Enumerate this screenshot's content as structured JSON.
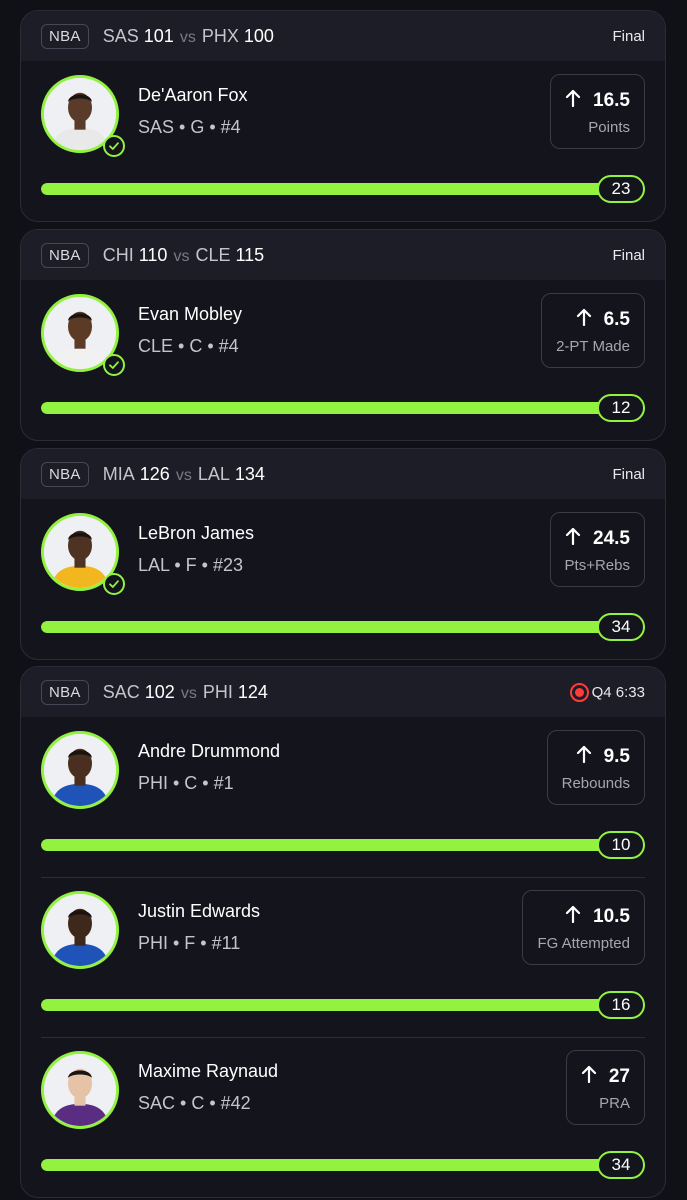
{
  "colors": {
    "background": "#101017",
    "card": "#14141d",
    "accent_green": "#93f240",
    "live_red": "#ff3b3b"
  },
  "games": [
    {
      "league": "NBA",
      "away_team": "SAS",
      "away_score": "101",
      "vs": "vs",
      "home_team": "PHX",
      "home_score": "100",
      "status": "Final",
      "live": false,
      "players": [
        {
          "name": "De'Aaron Fox",
          "meta": "SAS • G • #4",
          "line": "16.5",
          "stat": "Points",
          "actual": "23",
          "progress": 1.0,
          "hit": true,
          "jersey_color": "#e9e9ea",
          "skin": "#5a3a28"
        }
      ]
    },
    {
      "league": "NBA",
      "away_team": "CHI",
      "away_score": "110",
      "vs": "vs",
      "home_team": "CLE",
      "home_score": "115",
      "status": "Final",
      "live": false,
      "players": [
        {
          "name": "Evan Mobley",
          "meta": "CLE • C • #4",
          "line": "6.5",
          "stat": "2-PT Made",
          "actual": "12",
          "progress": 1.0,
          "hit": true,
          "jersey_color": "#f1f1f1",
          "skin": "#5b3a26"
        }
      ]
    },
    {
      "league": "NBA",
      "away_team": "MIA",
      "away_score": "126",
      "vs": "vs",
      "home_team": "LAL",
      "home_score": "134",
      "status": "Final",
      "live": false,
      "players": [
        {
          "name": "LeBron James",
          "meta": "LAL • F • #23",
          "line": "24.5",
          "stat": "Pts+Rebs",
          "actual": "34",
          "progress": 1.0,
          "hit": true,
          "jersey_color": "#f2b71e",
          "skin": "#4e3323"
        }
      ]
    },
    {
      "league": "NBA",
      "away_team": "SAC",
      "away_score": "102",
      "vs": "vs",
      "home_team": "PHI",
      "home_score": "124",
      "status": "Q4 6:33",
      "live": true,
      "players": [
        {
          "name": "Andre Drummond",
          "meta": "PHI • C • #1",
          "line": "9.5",
          "stat": "Rebounds",
          "actual": "10",
          "progress": 1.0,
          "hit": false,
          "jersey_color": "#1f53b8",
          "skin": "#4a2f20"
        },
        {
          "name": "Justin Edwards",
          "meta": "PHI • F • #11",
          "line": "10.5",
          "stat": "FG Attempted",
          "actual": "16",
          "progress": 1.0,
          "hit": false,
          "jersey_color": "#1f53b8",
          "skin": "#3e271b"
        },
        {
          "name": "Maxime Raynaud",
          "meta": "SAC • C • #42",
          "line": "27",
          "stat": "PRA",
          "actual": "34",
          "progress": 1.0,
          "hit": false,
          "jersey_color": "#5a2d82",
          "skin": "#e6c2a6"
        }
      ]
    }
  ]
}
